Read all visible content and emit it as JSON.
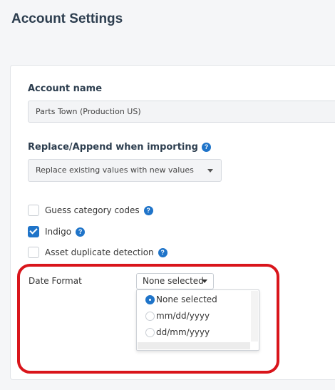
{
  "page": {
    "title": "Account Settings"
  },
  "account_name": {
    "label": "Account name",
    "value": "Parts Town (Production US)"
  },
  "replace_append": {
    "label": "Replace/Append when importing",
    "help_icon": "question-circle-icon",
    "selected": "Replace existing values with new values"
  },
  "checkboxes": [
    {
      "label": "Guess category codes",
      "checked": false
    },
    {
      "label": "Indigo",
      "checked": true
    },
    {
      "label": "Asset duplicate detection",
      "checked": false
    }
  ],
  "date_format": {
    "label": "Date Format",
    "button_label": "None selected",
    "options": [
      {
        "label": "None selected",
        "selected": true
      },
      {
        "label": "mm/dd/yyyy",
        "selected": false
      },
      {
        "label": "dd/mm/yyyy",
        "selected": false
      }
    ]
  },
  "colors": {
    "accent": "#1f74c9",
    "highlight": "#d9151b",
    "title": "#2d3e4f"
  }
}
